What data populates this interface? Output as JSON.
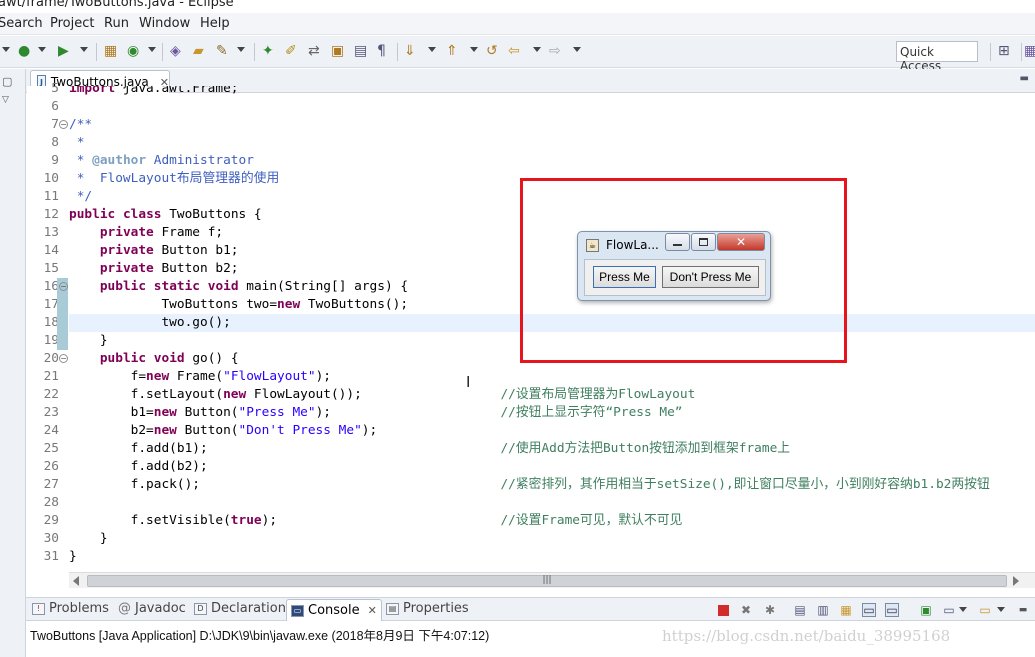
{
  "window": {
    "title": "awt/frame/TwoButtons.java - Eclipse"
  },
  "menu": [
    "Search",
    "Project",
    "Run",
    "Window",
    "Help"
  ],
  "quick_access": {
    "label": "Quick Access"
  },
  "editor": {
    "tab_label": "TwoButtons.java",
    "lines": [
      {
        "n": "5",
        "text": "import java.awt.Frame;"
      },
      {
        "n": "6",
        "text": ""
      },
      {
        "n": "7",
        "text": "/**"
      },
      {
        "n": "8",
        "text": " *"
      },
      {
        "n": "9",
        "text": " * @author Administrator"
      },
      {
        "n": "10",
        "text": " *  FlowLayout布局管理器的使用"
      },
      {
        "n": "11",
        "text": " */"
      },
      {
        "n": "12",
        "text": "public class TwoButtons {"
      },
      {
        "n": "13",
        "text": "    private Frame f;"
      },
      {
        "n": "14",
        "text": "    private Button b1;"
      },
      {
        "n": "15",
        "text": "    private Button b2;"
      },
      {
        "n": "16",
        "text": "    public static void main(String[] args) {"
      },
      {
        "n": "17",
        "text": "            TwoButtons two=new TwoButtons();"
      },
      {
        "n": "18",
        "text": "            two.go();"
      },
      {
        "n": "19",
        "text": "    }"
      },
      {
        "n": "20",
        "text": "    public void go() {"
      },
      {
        "n": "21",
        "text": "        f=new Frame(\"FlowLayout\");"
      },
      {
        "n": "22",
        "text": "        f.setLayout(new FlowLayout());"
      },
      {
        "n": "23",
        "text": "        b1=new Button(\"Press Me\");"
      },
      {
        "n": "24",
        "text": "        b2=new Button(\"Don't Press Me\");"
      },
      {
        "n": "25",
        "text": "        f.add(b1);"
      },
      {
        "n": "26",
        "text": "        f.add(b2);"
      },
      {
        "n": "27",
        "text": "        f.pack();"
      },
      {
        "n": "28",
        "text": ""
      },
      {
        "n": "29",
        "text": "        f.setVisible(true);"
      },
      {
        "n": "30",
        "text": "    }"
      },
      {
        "n": "31",
        "text": "}"
      }
    ],
    "comments": {
      "22": "//设置布局管理器为FlowLayout",
      "23": "//按钮上显示字符“Press Me”",
      "25": "//使用Add方法把Button按钮添加到框架frame上",
      "27": "//紧密排列，其作用相当于setSize(),即让窗口尽量小，小到刚好容纳b1.b2两按钮",
      "29": "//设置Frame可见，默认不可见"
    }
  },
  "awt_frame": {
    "title": "FlowLa...",
    "buttons": [
      "Press Me",
      "Don't Press Me"
    ]
  },
  "bottom_tabs": [
    "Problems",
    "Javadoc",
    "Declaration",
    "Console",
    "Properties"
  ],
  "console": {
    "info": "TwoButtons [Java Application] D:\\JDK\\9\\bin\\javaw.exe (2018年8月9日 下午4:07:12)"
  },
  "watermark": "https://blog.csdn.net/baidu_38995168",
  "colors": {
    "highlight_box": "#e6141d",
    "keyword": "#7f0055",
    "string": "#2a00ff",
    "comment": "#3f7f5f"
  }
}
